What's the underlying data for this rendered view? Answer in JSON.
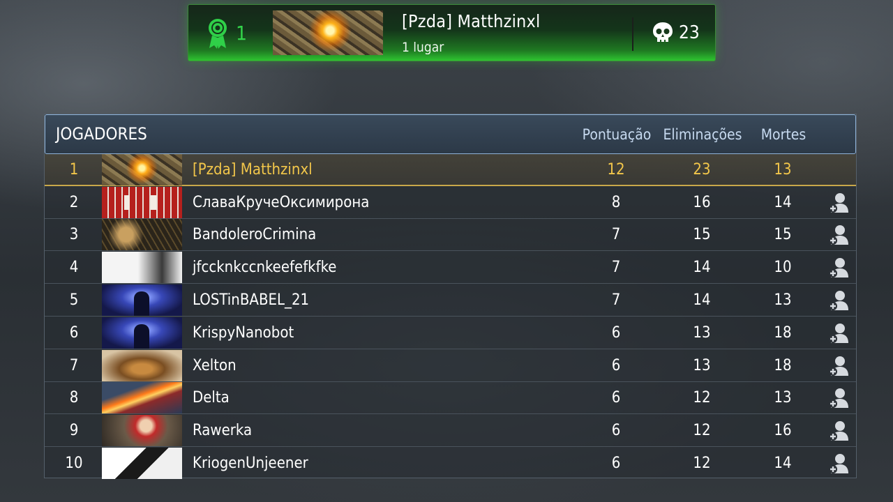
{
  "winner": {
    "rank": "1",
    "name": "[Pzda] Matthzinxl",
    "place_label": "1 lugar",
    "kills": "23"
  },
  "board": {
    "title": "JOGADORES",
    "columns": {
      "score": "Pontuação",
      "kills": "Eliminações",
      "deaths": "Mortes"
    },
    "rows": [
      {
        "pos": "1",
        "name": "[Pzda] Matthzinxl",
        "score": "12",
        "kills": "23",
        "deaths": "13"
      },
      {
        "pos": "2",
        "name": "СлаваКручеОксимирона",
        "score": "8",
        "kills": "16",
        "deaths": "14"
      },
      {
        "pos": "3",
        "name": "BandoleroCrimina",
        "score": "7",
        "kills": "15",
        "deaths": "15"
      },
      {
        "pos": "4",
        "name": "jfccknkccnkeefefkfke",
        "score": "7",
        "kills": "14",
        "deaths": "10"
      },
      {
        "pos": "5",
        "name": "LOSTinBABEL_21",
        "score": "7",
        "kills": "14",
        "deaths": "13"
      },
      {
        "pos": "6",
        "name": "KrispyNanobot",
        "score": "6",
        "kills": "13",
        "deaths": "18"
      },
      {
        "pos": "7",
        "name": "Xelton",
        "score": "6",
        "kills": "13",
        "deaths": "18"
      },
      {
        "pos": "8",
        "name": "Delta",
        "score": "6",
        "kills": "12",
        "deaths": "13"
      },
      {
        "pos": "9",
        "name": "Rawerka",
        "score": "6",
        "kills": "12",
        "deaths": "16"
      },
      {
        "pos": "10",
        "name": "KriogenUnjeener",
        "score": "6",
        "kills": "12",
        "deaths": "14"
      }
    ]
  },
  "colors": {
    "winner_green": "#2ec430",
    "first_place_gold": "#f2c64a",
    "header_blue": "#c7daf0"
  },
  "icons": {
    "rank": "award-ribbon-icon",
    "kills": "skull-icon",
    "add_friend": "add-friend-icon"
  }
}
